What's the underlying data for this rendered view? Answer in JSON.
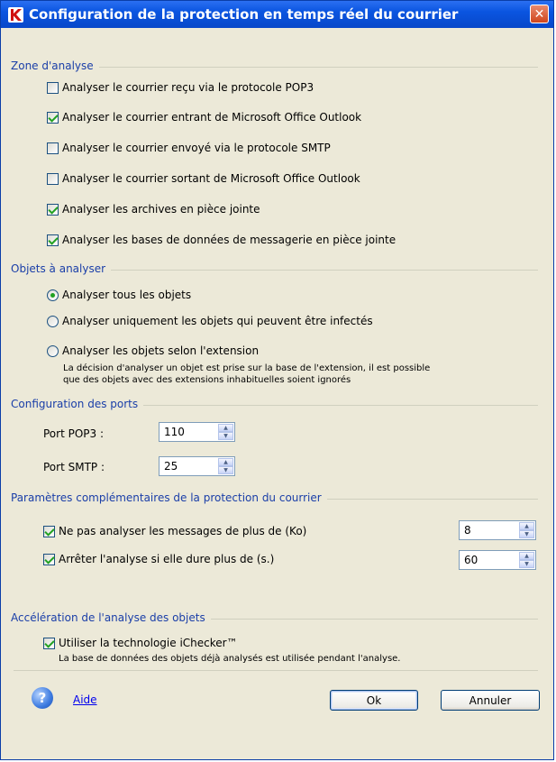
{
  "window": {
    "title": "Configuration de la protection en temps réel du courrier",
    "close_label": "✕"
  },
  "zone_analyse": {
    "label": "Zone d'analyse",
    "items": [
      {
        "label": "Analyser le courrier reçu via le protocole POP3",
        "checked": false
      },
      {
        "label": "Analyser le courrier entrant de Microsoft Office Outlook",
        "checked": true
      },
      {
        "label": "Analyser le courrier envoyé via le protocole SMTP",
        "checked": false
      },
      {
        "label": "Analyser le courrier sortant de Microsoft Office Outlook",
        "checked": false
      },
      {
        "label": "Analyser les archives en pièce jointe",
        "checked": true
      },
      {
        "label": "Analyser les bases de données de messagerie en pièce jointe",
        "checked": true
      }
    ]
  },
  "objets": {
    "label": "Objets à analyser",
    "options": [
      {
        "label": "Analyser tous les objets",
        "selected": true
      },
      {
        "label": "Analyser uniquement les objets qui peuvent être infectés",
        "selected": false
      },
      {
        "label": "Analyser les objets selon l'extension",
        "selected": false
      }
    ],
    "extension_desc_line1": "La décision d'analyser un objet est prise sur la base de l'extension, il est possible",
    "extension_desc_line2": "que des objets avec des extensions inhabituelles soient ignorés"
  },
  "ports": {
    "label": "Configuration des ports",
    "pop3_label": "Port POP3 :",
    "pop3_value": "110",
    "smtp_label": "Port SMTP :",
    "smtp_value": "25"
  },
  "params": {
    "label": "Paramètres complémentaires de la protection du courrier",
    "size_label": "Ne pas analyser les messages de plus de (Ko)",
    "size_checked": true,
    "size_value": "8",
    "time_label": "Arrêter l'analyse si elle dure plus de (s.)",
    "time_checked": true,
    "time_value": "60"
  },
  "acceleration": {
    "label": "Accélération de l'analyse des objets",
    "ichecker_label": "Utiliser la technologie iChecker™",
    "ichecker_checked": true,
    "ichecker_desc": "La base de données des objets déjà analysés est utilisée pendant l'analyse."
  },
  "footer": {
    "help_label": "Aide",
    "ok_label": "Ok",
    "cancel_label": "Annuler"
  },
  "icons": {
    "app_logo": "kaspersky-k-icon",
    "help": "help-question-icon",
    "close": "close-icon"
  }
}
